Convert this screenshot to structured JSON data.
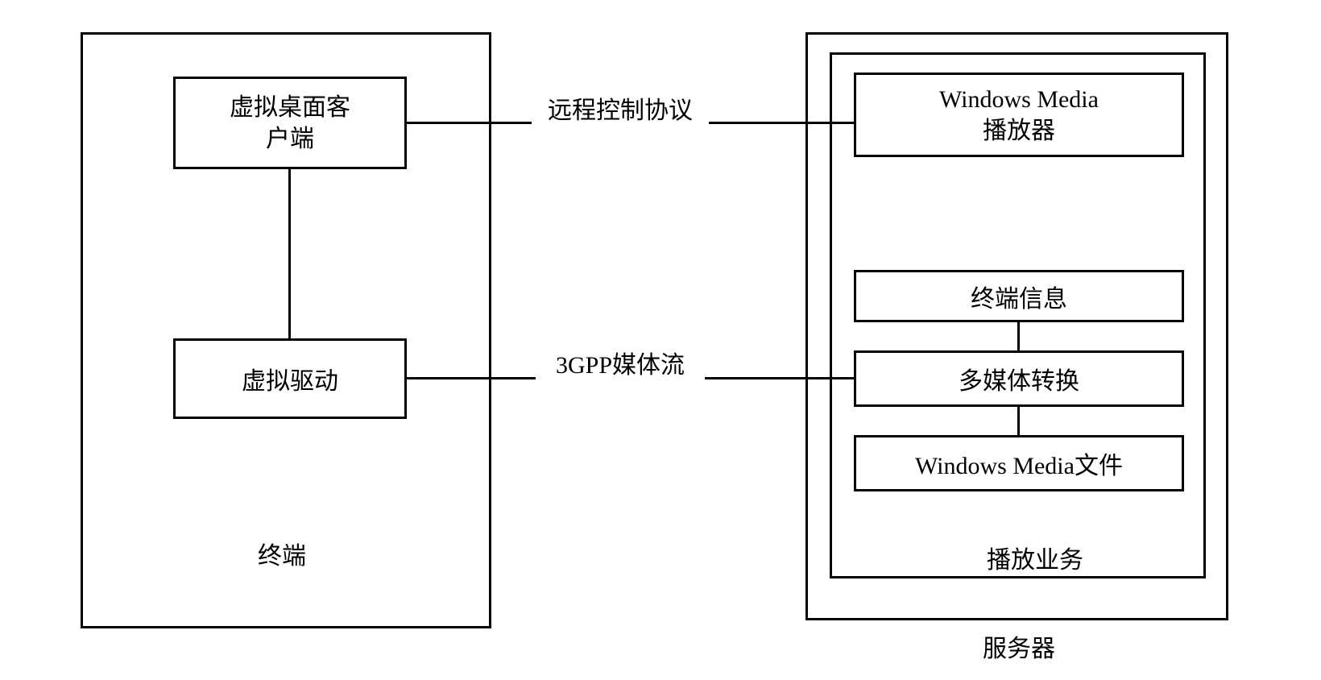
{
  "terminal": {
    "label": "终端",
    "virtual_desktop_client": "虚拟桌面客\n户端",
    "virtual_driver": "虚拟驱动"
  },
  "server": {
    "label": "服务器",
    "playback_service": {
      "label": "播放业务",
      "windows_media_player": "Windows Media\n播放器",
      "terminal_info": "终端信息",
      "multimedia_conversion": "多媒体转换",
      "windows_media_file": "Windows Media文件"
    }
  },
  "connections": {
    "remote_control_protocol": "远程控制协议",
    "gpp_media_stream": "3GPP媒体流"
  }
}
